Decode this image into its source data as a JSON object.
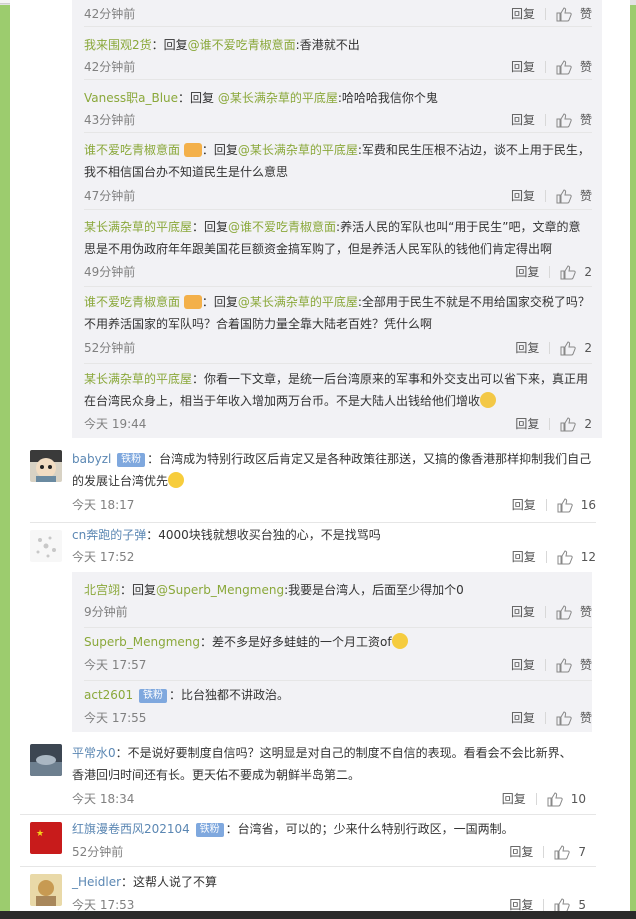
{
  "ui": {
    "reply_label": "回复",
    "zan_label": "赞"
  },
  "subcomments_a": [
    {
      "user": "",
      "badge": "",
      "prefix": "",
      "mention": "",
      "body": "",
      "time": "42分钟前",
      "likes": ""
    },
    {
      "user": "我来围观2货",
      "badge": "",
      "prefix": "：回复",
      "mention": "@谁不爱吃青椒意面",
      "body": ":香港就不出",
      "time": "42分钟前",
      "likes": ""
    },
    {
      "user": "Vaness职a_Blue",
      "badge": "",
      "prefix": "：回复 ",
      "mention": "@某长满杂草的平底屋",
      "body": ":哈哈哈我信你个鬼",
      "time": "43分钟前",
      "likes": ""
    },
    {
      "user": "谁不爱吃青椒意面",
      "badge": "",
      "prefix": "：回复",
      "mention": "@某长满杂草的平底屋",
      "body": ":军费和民生压根不沾边，谈不上用于民生，我不相信国台办不知道民生是什么意思",
      "time": "47分钟前",
      "likes": ""
    },
    {
      "user": "某长满杂草的平底屋",
      "badge": "",
      "prefix": "：回复",
      "mention": "@谁不爱吃青椒意面",
      "body": ":养活人民的军队也叫“用于民生”吧，文章的意思是不用伪政府年年跟美国花巨额资金搞军购了，但是养活人民军队的钱他们肯定得出啊",
      "time": "49分钟前",
      "likes": "2"
    },
    {
      "user": "谁不爱吃青椒意面",
      "badge": "",
      "prefix": "：回复",
      "mention": "@某长满杂草的平底屋",
      "body": ":全部用于民生不就是不用给国家交税了吗？不用养活国家的军队吗？合着国防力量全靠大陆老百姓？凭什么啊",
      "time": "52分钟前",
      "likes": "2"
    },
    {
      "user": "某长满杂草的平底屋",
      "badge": "",
      "prefix": "",
      "mention": "",
      "body": "：你看一下文章，是统一后台湾原来的军事和外交支出可以省下来，真正用在台湾民众身上，相当于年收入增加两万台币。不是大陆人出钱给他们增收",
      "time": "今天 19:44",
      "likes": "2"
    }
  ],
  "comment_babyzl": {
    "user": "babyzl",
    "badge": "铁粉",
    "body": "：台湾成为特别行政区后肯定又是各种政策往那送，又搞的像香港那样抑制我们自己的发展让台湾优先",
    "time": "今天 18:17",
    "likes": "16"
  },
  "comment_cn": {
    "user": "cn奔跑的子弹",
    "badge": "",
    "body": "：4000块钱就想收买台独的心，不是找骂吗",
    "time": "今天 17:52",
    "likes": "12"
  },
  "subcomments_b": [
    {
      "user": "北宫翊",
      "badge": "",
      "prefix": "：回复",
      "mention": "@Superb_Mengmeng",
      "body": ":我要是台湾人，后面至少得加个0",
      "time": "9分钟前",
      "likes": ""
    },
    {
      "user": "Superb_Mengmeng",
      "badge": "",
      "prefix": "",
      "mention": "",
      "body": "：差不多是好多蛙蛙的一个月工资of",
      "time": "今天 17:57",
      "likes": ""
    },
    {
      "user": "act2601",
      "badge": "铁粉",
      "prefix": "",
      "mention": "",
      "body": "：比台独都不讲政治。",
      "time": "今天 17:55",
      "likes": ""
    }
  ],
  "comment_pcs": {
    "user": "平常水0",
    "badge": "",
    "body": "：不是说好要制度自信吗？这明显是对自己的制度不自信的表现。看看会不会比新界、香港回归时间还有长。更天佑不要成为朝鲜半岛第二。",
    "time": "今天 18:34",
    "likes": "10"
  },
  "comment_hq": {
    "user": "红旗漫卷西风202104",
    "badge": "铁粉",
    "body": "：台湾省，可以的；少来什么特别行政区，一国两制。",
    "time": "52分钟前",
    "likes": "7"
  },
  "comment_heidler": {
    "user": "_Heidler",
    "badge": "",
    "body": "：这帮人说了不算",
    "time": "今天 17:53",
    "likes": "5"
  },
  "colors": {
    "page_bg": "#9ccc6e",
    "link": "#8aa83a",
    "badge": "#7fa8de",
    "sub_bg": "#f2f2f5"
  }
}
